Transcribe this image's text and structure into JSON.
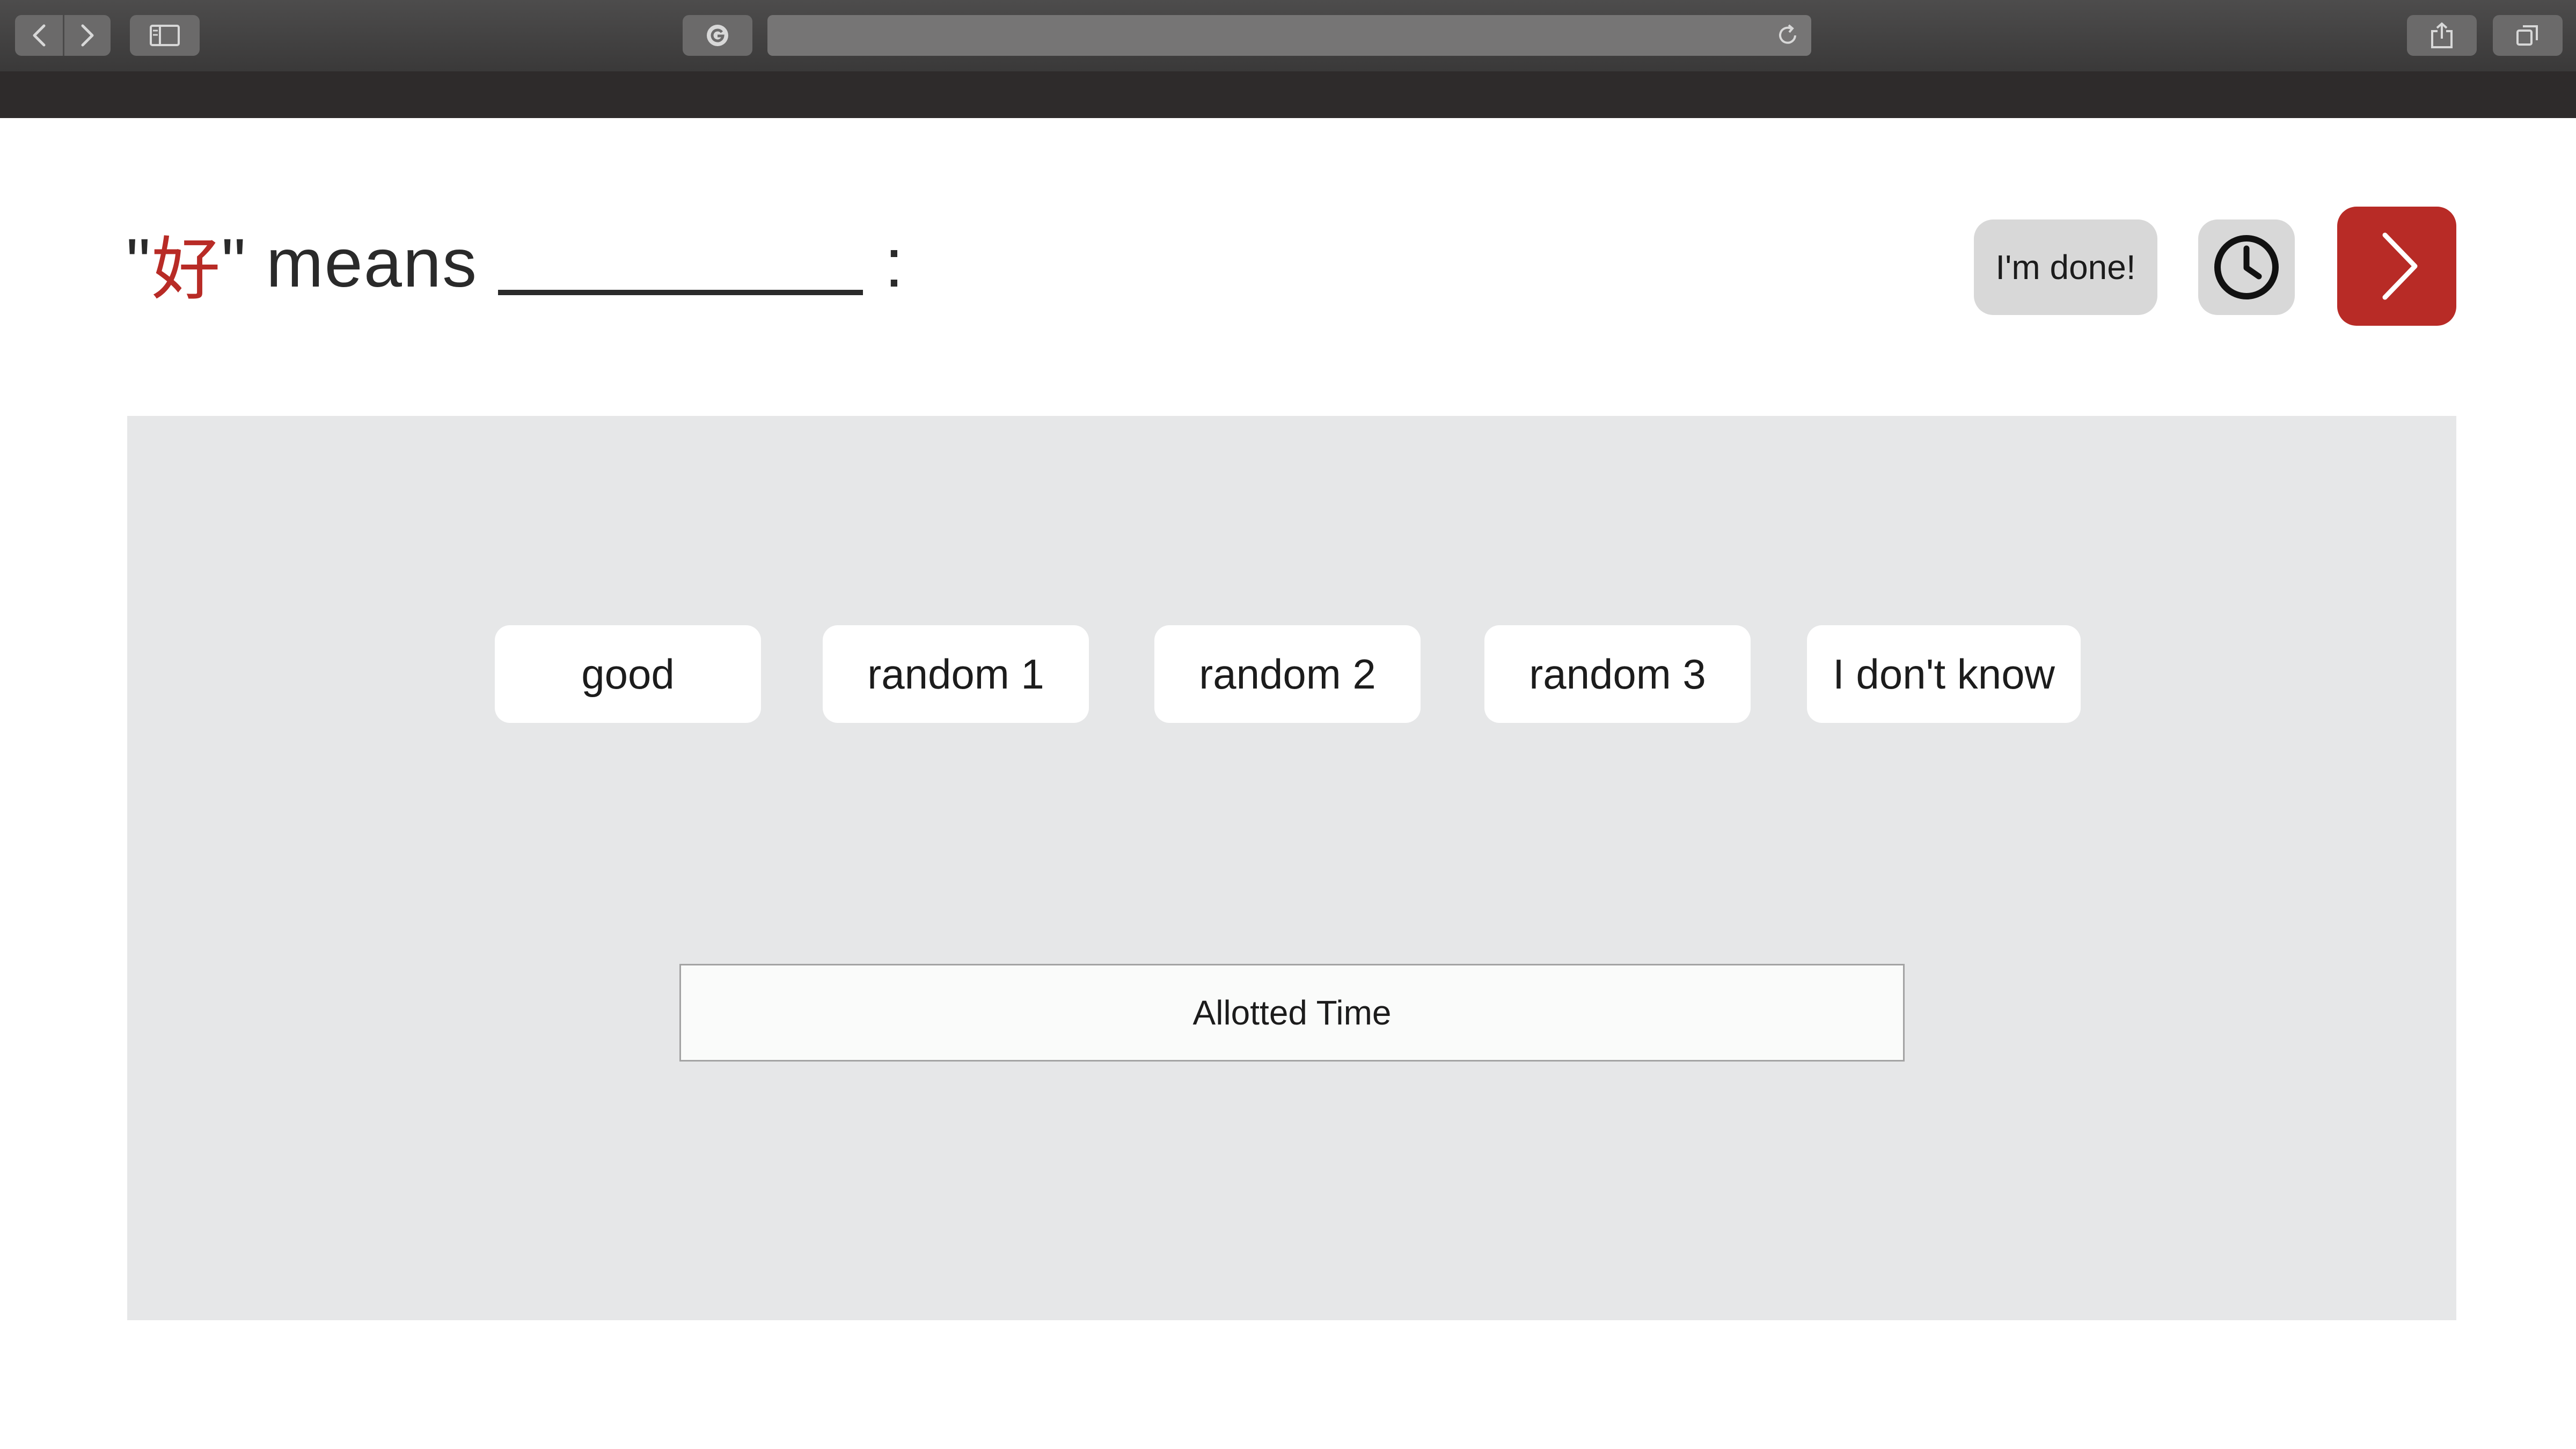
{
  "browser": {
    "icons": [
      "back-icon",
      "forward-icon",
      "sidebar-icon",
      "site-icon",
      "reload-icon",
      "share-icon",
      "tabs-icon"
    ]
  },
  "question": {
    "quote_open": "\"",
    "character": "好",
    "quote_close": "\"",
    "means_text": "means",
    "colon": ":"
  },
  "header_actions": {
    "done_label": "I'm done!",
    "clock_icon": "clock-icon",
    "next_icon": "chevron-right-icon"
  },
  "options": [
    {
      "label": "good"
    },
    {
      "label": "random 1"
    },
    {
      "label": "random 2"
    },
    {
      "label": "random 3"
    },
    {
      "label": "I don't know"
    }
  ],
  "timer": {
    "label": "Allotted Time"
  },
  "colors": {
    "accent_red": "#b82b26",
    "panel_gray": "#e6e7e8",
    "button_gray": "#d8d8d8",
    "chrome_dark": "#2e2b2b"
  }
}
